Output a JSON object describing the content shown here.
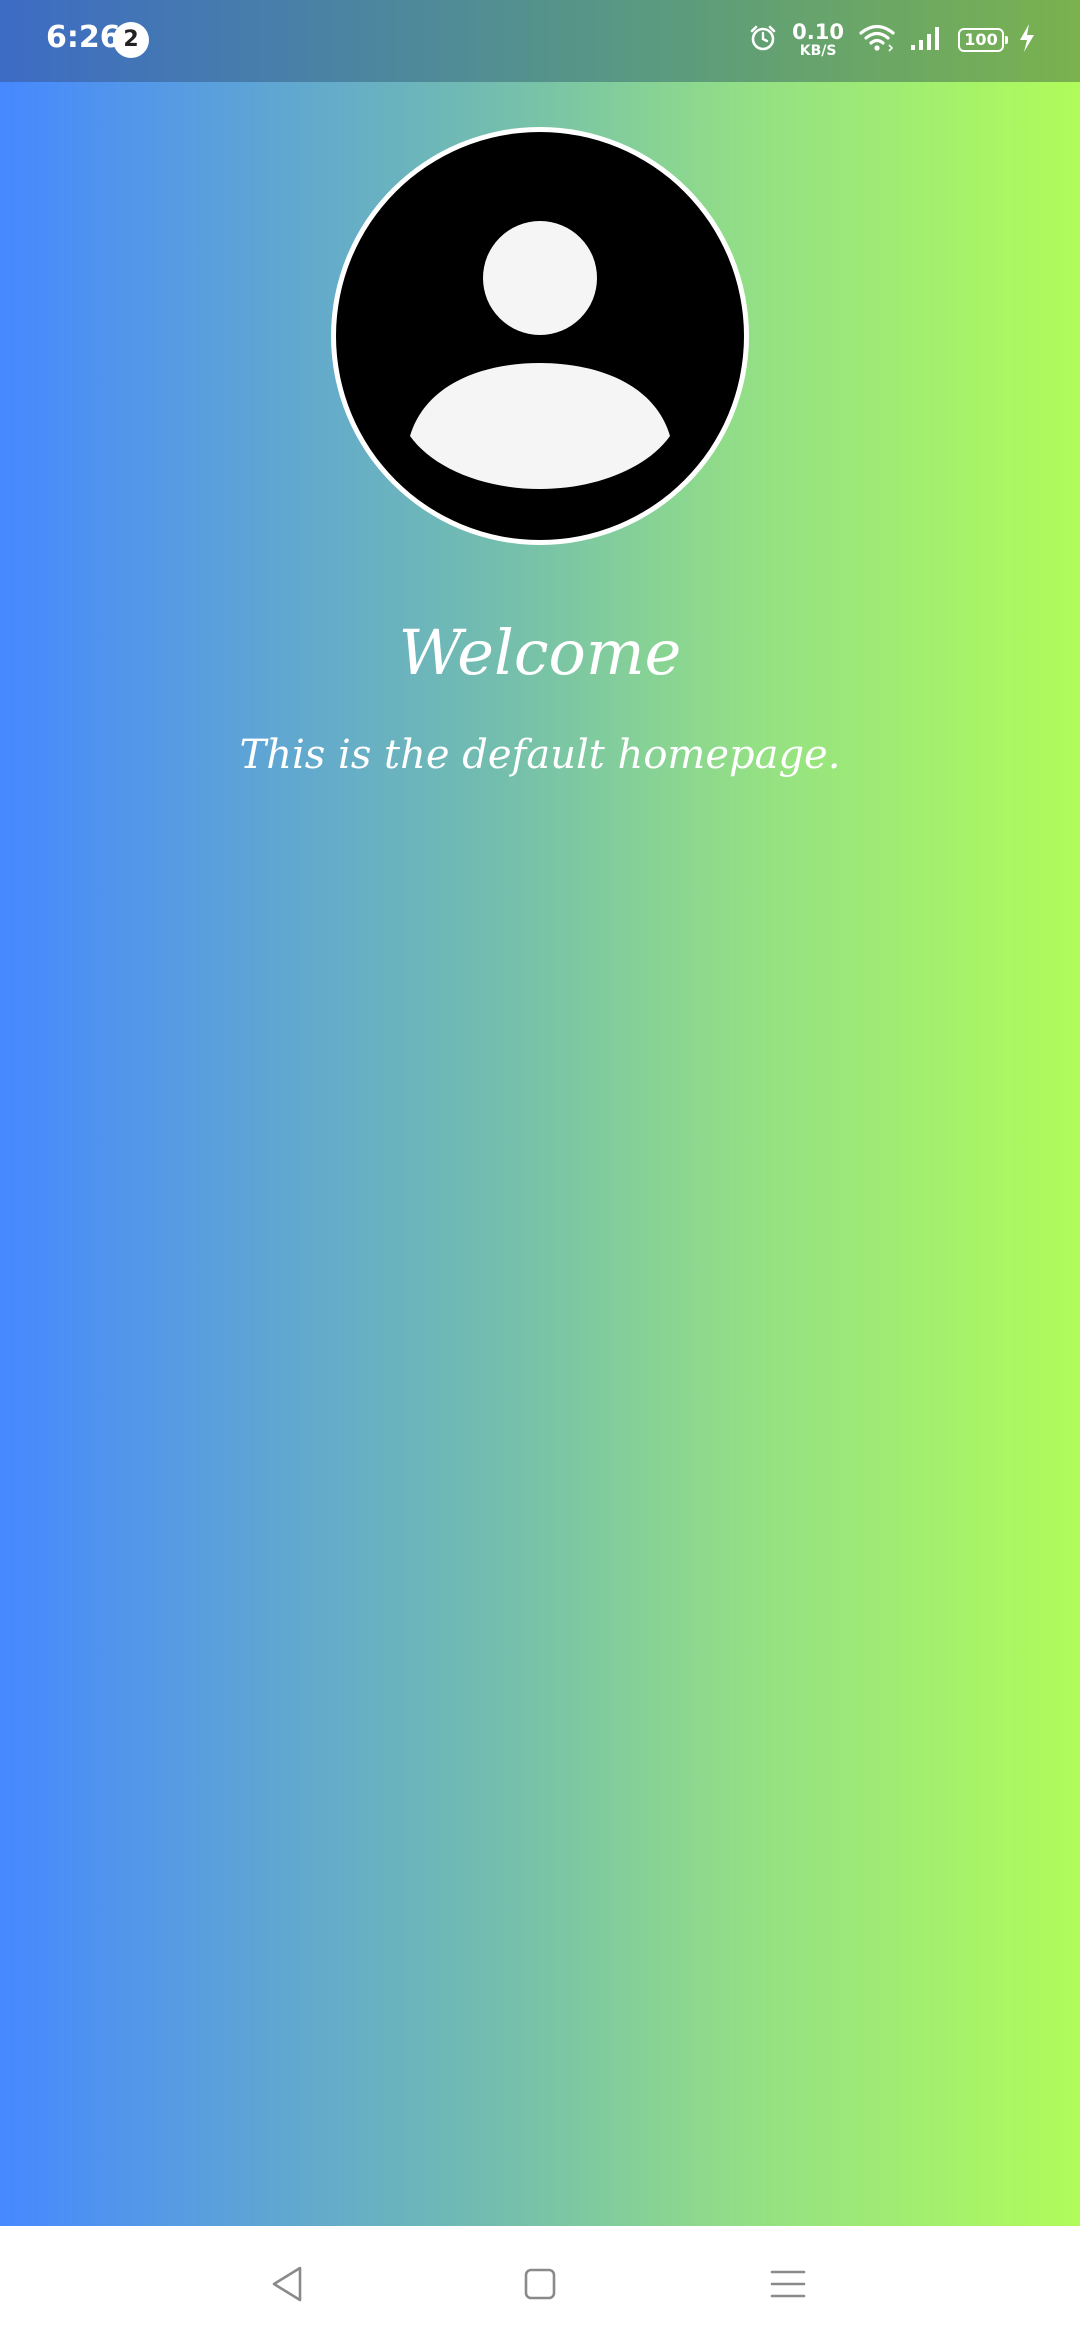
{
  "status_bar": {
    "time": "6:26",
    "notification_count": "2",
    "net_speed_value": "0.10",
    "net_speed_unit": "KB/S",
    "battery_level": "100",
    "icons": [
      "alarm-icon",
      "wifi-icon",
      "signal-icon",
      "battery-icon",
      "charging-icon"
    ]
  },
  "main": {
    "avatar_icon": "person-icon",
    "title": "Welcome",
    "subtitle": "This is the default homepage."
  },
  "nav_bar": {
    "icons": [
      "back-icon",
      "home-icon",
      "menu-icon"
    ]
  },
  "colors": {
    "gradient_start": "#4688ff",
    "gradient_end": "#b0fc5a",
    "text": "#ffffff"
  }
}
